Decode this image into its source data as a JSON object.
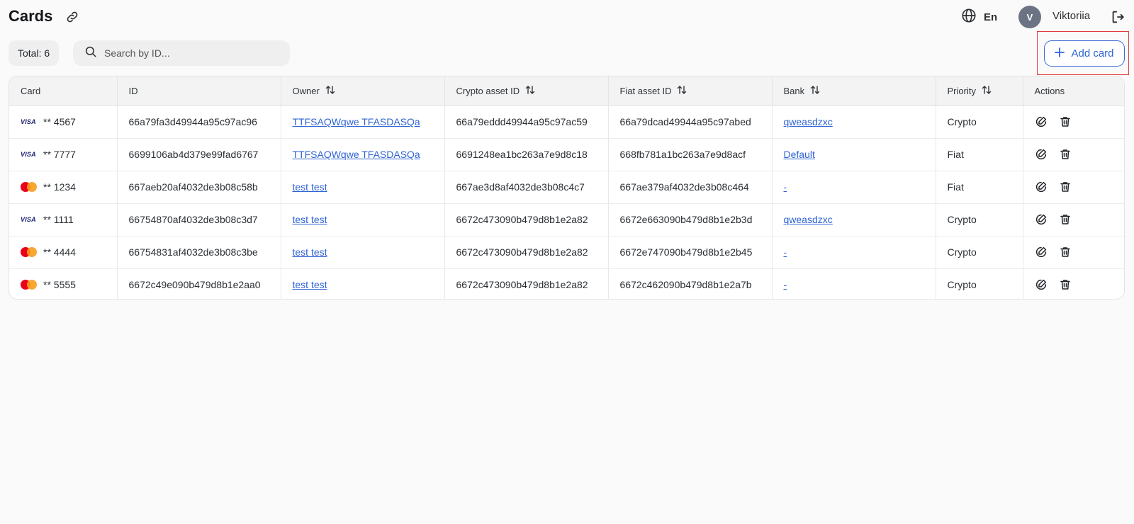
{
  "header": {
    "title": "Cards",
    "language": "En",
    "user_initial": "V",
    "user_name": "Viktoriia"
  },
  "toolbar": {
    "total_label": "Total: 6",
    "search_placeholder": "Search by ID...",
    "add_label": "Add card"
  },
  "table": {
    "columns": [
      "Card",
      "ID",
      "Owner",
      "Crypto asset ID",
      "Fiat asset ID",
      "Bank",
      "Priority",
      "Actions"
    ],
    "rows": [
      {
        "brand": "visa",
        "brand_label": "VISA",
        "card": "** 4567",
        "id": "66a79fa3d49944a95c97ac96",
        "owner": "TTFSAQWqwe TFASDASQa",
        "crypto": "66a79eddd49944a95c97ac59",
        "fiat": "66a79dcad49944a95c97abed",
        "bank": "qweasdzxc",
        "priority": "Crypto"
      },
      {
        "brand": "visa",
        "brand_label": "VISA",
        "card": "** 7777",
        "id": "6699106ab4d379e99fad6767",
        "owner": "TTFSAQWqwe TFASDASQa",
        "crypto": "6691248ea1bc263a7e9d8c18",
        "fiat": "668fb781a1bc263a7e9d8acf",
        "bank": "Default",
        "priority": "Fiat"
      },
      {
        "brand": "mastercard",
        "brand_label": "",
        "card": "** 1234",
        "id": "667aeb20af4032de3b08c58b",
        "owner": "test test",
        "crypto": "667ae3d8af4032de3b08c4c7",
        "fiat": "667ae379af4032de3b08c464",
        "bank": "-",
        "priority": "Fiat"
      },
      {
        "brand": "visa",
        "brand_label": "VISA",
        "card": "** 1111",
        "id": "66754870af4032de3b08c3d7",
        "owner": "test test",
        "crypto": "6672c473090b479d8b1e2a82",
        "fiat": "6672e663090b479d8b1e2b3d",
        "bank": "qweasdzxc",
        "priority": "Crypto"
      },
      {
        "brand": "mastercard",
        "brand_label": "",
        "card": "** 4444",
        "id": "66754831af4032de3b08c3be",
        "owner": "test test",
        "crypto": "6672c473090b479d8b1e2a82",
        "fiat": "6672e747090b479d8b1e2b45",
        "bank": "-",
        "priority": "Crypto"
      },
      {
        "brand": "mastercard",
        "brand_label": "",
        "card": "** 5555",
        "id": "6672c49e090b479d8b1e2aa0",
        "owner": "test test",
        "crypto": "6672c473090b479d8b1e2a82",
        "fiat": "6672c462090b479d8b1e2a7b",
        "bank": "-",
        "priority": "Crypto"
      }
    ]
  },
  "colors": {
    "accent": "#2f63d4",
    "highlight": "#e23b3b",
    "avatar_bg": "#6b7384",
    "visa": "#1a1f71",
    "mastercard_red": "#eb001b",
    "mastercard_orange": "#f79e1b"
  },
  "icons": {
    "title_action": "link-icon",
    "language": "globe-icon",
    "logout": "logout-icon",
    "search": "search-icon",
    "add": "plus-icon",
    "sort": "sort-icon",
    "edit": "edit-icon",
    "delete": "trash-icon"
  }
}
